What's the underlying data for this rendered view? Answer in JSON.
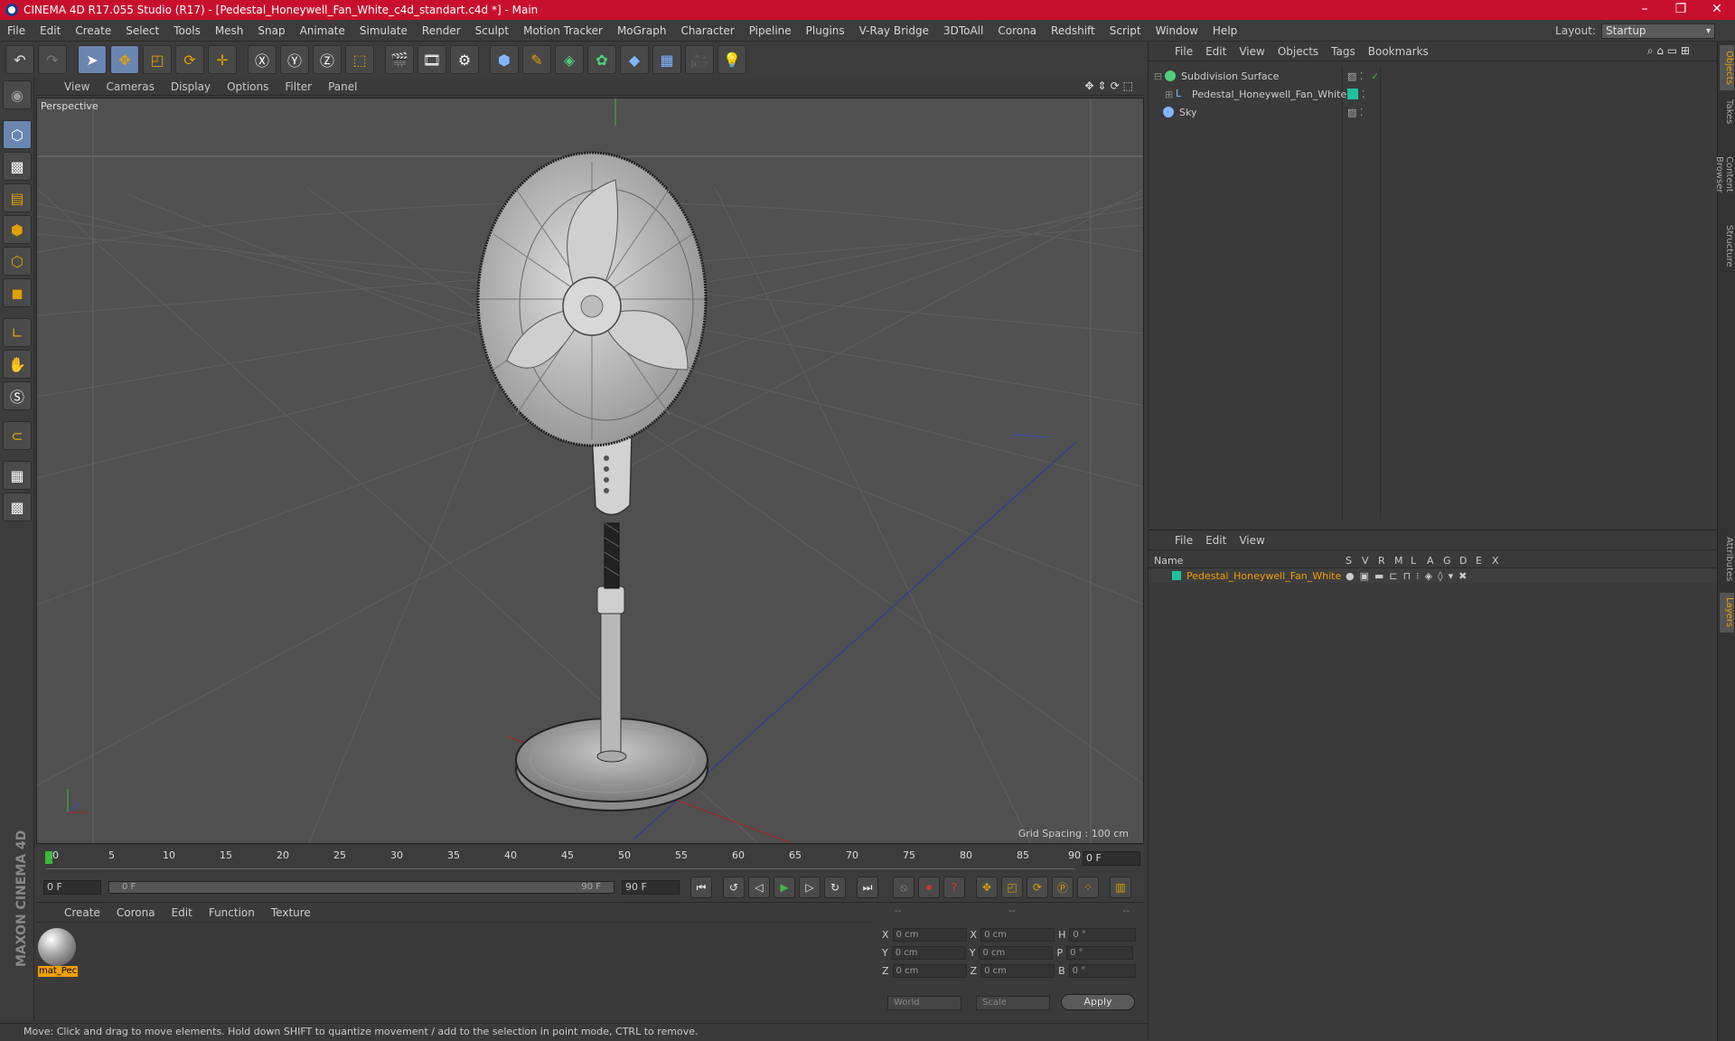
{
  "title": "CINEMA 4D R17.055 Studio (R17) - [Pedestal_Honeywell_Fan_White_c4d_standart.c4d *] - Main",
  "menu": [
    "File",
    "Edit",
    "Create",
    "Select",
    "Tools",
    "Mesh",
    "Snap",
    "Animate",
    "Simulate",
    "Render",
    "Sculpt",
    "Motion Tracker",
    "MoGraph",
    "Character",
    "Pipeline",
    "Plugins",
    "V-Ray Bridge",
    "3DToAll",
    "Corona",
    "Redshift",
    "Script",
    "Window",
    "Help"
  ],
  "layout": {
    "label": "Layout:",
    "value": "Startup"
  },
  "viewport": {
    "menu": [
      "View",
      "Cameras",
      "Display",
      "Options",
      "Filter",
      "Panel"
    ],
    "label": "Perspective",
    "grid_spacing": "Grid Spacing : 100 cm"
  },
  "timeline": {
    "ticks": [
      "0",
      "5",
      "10",
      "15",
      "20",
      "25",
      "30",
      "35",
      "40",
      "45",
      "50",
      "55",
      "60",
      "65",
      "70",
      "75",
      "80",
      "85",
      "90"
    ],
    "current": "0 F"
  },
  "transport": {
    "start": "0 F",
    "range_start": "0 F",
    "range_end": "90 F",
    "end": "90 F"
  },
  "materials": {
    "menu": [
      "Create",
      "Corona",
      "Edit",
      "Function",
      "Texture"
    ],
    "items": [
      {
        "name": "mat_Pec"
      }
    ]
  },
  "coords": {
    "header": [
      "--",
      "--",
      "--"
    ],
    "rows": [
      {
        "a": "X",
        "av": "0 cm",
        "b": "X",
        "bv": "0 cm",
        "c": "H",
        "cv": "0 °"
      },
      {
        "a": "Y",
        "av": "0 cm",
        "b": "Y",
        "bv": "0 cm",
        "c": "P",
        "cv": "0 °"
      },
      {
        "a": "Z",
        "av": "0 cm",
        "b": "Z",
        "bv": "0 cm",
        "c": "B",
        "cv": "0 °"
      }
    ],
    "world": "World",
    "scale": "Scale",
    "apply": "Apply"
  },
  "status": "Move: Click and drag to move elements. Hold down SHIFT to quantize movement / add to the selection in point mode, CTRL to remove.",
  "objects": {
    "menu": [
      "File",
      "Edit",
      "View",
      "Objects",
      "Tags",
      "Bookmarks"
    ],
    "items": [
      {
        "name": "Subdivision Surface"
      },
      {
        "name": "Pedestal_Honeywell_Fan_White"
      },
      {
        "name": "Sky"
      }
    ]
  },
  "layers": {
    "menu": [
      "File",
      "Edit",
      "View"
    ],
    "columns": [
      "Name",
      "S",
      "V",
      "R",
      "M",
      "L",
      "A",
      "G",
      "D",
      "E",
      "X"
    ],
    "items": [
      {
        "name": "Pedestal_Honeywell_Fan_White",
        "color": "#1fbf9f"
      }
    ]
  },
  "side_tabs": [
    "Objects",
    "Takes",
    "Content Browser",
    "Structure",
    "Attributes",
    "Layers"
  ],
  "brand": "MAXON CINEMA 4D",
  "colors": {
    "titlebar": "#c8102e",
    "accent": "#f0a000",
    "selected_tool": "#6a86b0"
  }
}
